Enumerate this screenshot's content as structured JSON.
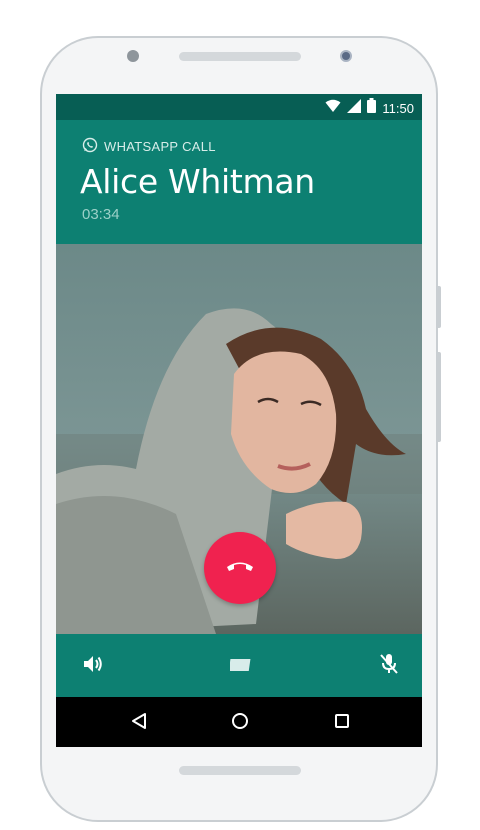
{
  "status_bar": {
    "time": "11:50",
    "icons": [
      "wifi-icon",
      "signal-icon",
      "battery-icon"
    ]
  },
  "call": {
    "label": "WHATSAPP CALL",
    "caller_name": "Alice Whitman",
    "duration": "03:34"
  },
  "controls": {
    "icons": [
      "speaker-icon",
      "video-icon",
      "mic-off-icon"
    ],
    "end_call_icon": "phone-hangup-icon"
  },
  "navigation": {
    "icons": [
      "back-icon",
      "home-icon",
      "recent-apps-icon"
    ]
  },
  "colors": {
    "header": "#0d8072",
    "status_bar": "#075e54",
    "end_call": "#f0224f"
  }
}
